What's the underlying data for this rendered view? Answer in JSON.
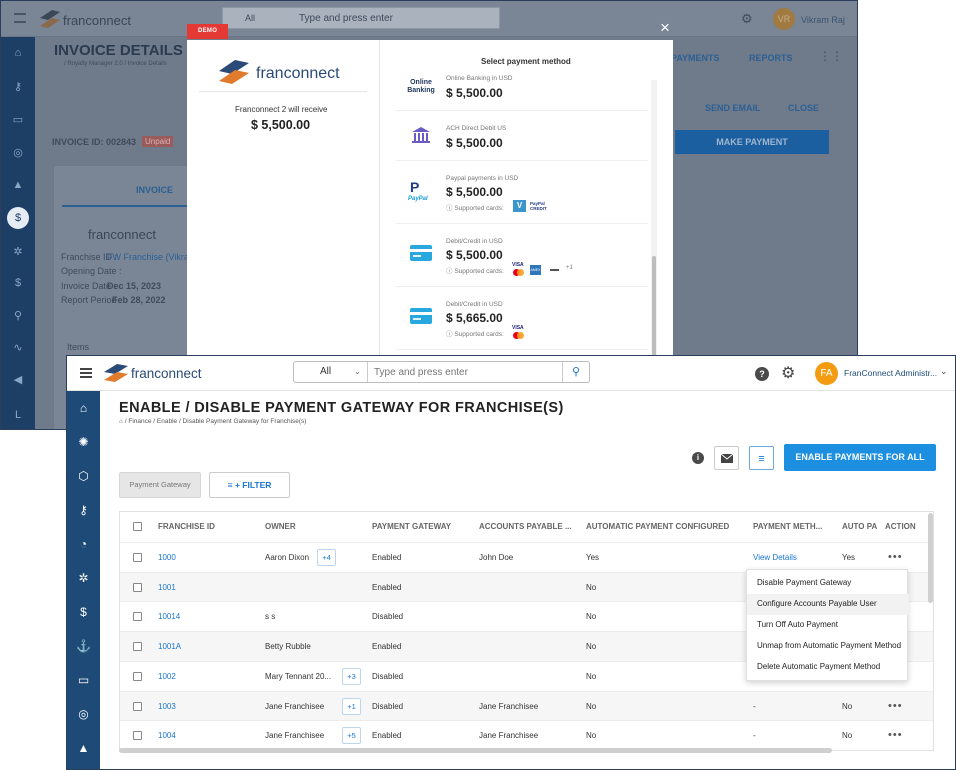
{
  "back_window": {
    "search_scope": "All",
    "search_placeholder": "Type and press enter",
    "user_initials": "VR",
    "user_name": "Vikram Raj",
    "page_title": "INVOICE DETAILS",
    "breadcrumb": "/ Royalty Manager 2.0 / Invoice Details",
    "tabs": [
      "PAYMENTS",
      "REPORTS"
    ],
    "actions": [
      "SEND EMAIL",
      "CLOSE"
    ],
    "make_payment": "MAKE PAYMENT",
    "invoice_id": "INVOICE ID: 002843",
    "status": "Unpaid",
    "invoice_tab": "INVOICE",
    "logo": "franconnect",
    "franchise_id_label": "Franchise ID :",
    "franchise_id_value": "FW Franchise (Vikram R",
    "opening_date_label": "Opening Date :",
    "invoice_date_label": "Invoice Date :",
    "invoice_date_value": "Dec 15, 2023",
    "report_period_label": "Report Period :",
    "report_period_value": "Feb 28, 2022",
    "items_label": "Items"
  },
  "modal": {
    "demo_badge": "DEMO",
    "close_glyph": "×",
    "brand": "franconnect",
    "receive_text": "Franconnect 2 will receive",
    "receive_amount": "$ 5,500.00",
    "header": "Select payment method",
    "methods": [
      {
        "icon": "online-banking-icon",
        "logo_text": "Online Banking",
        "label": "Online Banking in USD",
        "amount": "$ 5,500.00",
        "supported": ""
      },
      {
        "icon": "bank-icon",
        "label": "ACH Direct Debit US",
        "amount": "$ 5,500.00",
        "supported": ""
      },
      {
        "icon": "paypal-icon",
        "logo_text": "PayPal",
        "label": "Paypal payments in USD",
        "amount": "$ 5,500.00",
        "supported": "Supported cards:",
        "cards": [
          "V",
          "PayPal CREDIT"
        ]
      },
      {
        "icon": "credit-card-icon",
        "label": "Debit/Credit in USD",
        "amount": "$ 5,500.00",
        "supported": "Supported cards:",
        "cards": [
          "VISA",
          "AMEX",
          "+1"
        ]
      },
      {
        "icon": "credit-card-icon",
        "label": "Debit/Credit in USD",
        "amount": "$ 5,665.00",
        "supported": "Supported cards:",
        "cards": [
          "VISA"
        ]
      }
    ]
  },
  "front_window": {
    "brand": "franconnect",
    "search_scope": "All",
    "search_placeholder": "Type and press enter",
    "user_initials": "FA",
    "user_name": "FranConnect Administr...",
    "page_title": "ENABLE / DISABLE PAYMENT GATEWAY FOR FRANCHISE(S)",
    "breadcrumb": "/ Finance / Enable / Disable Payment Gateway for Franchise(s)",
    "enable_all_button": "ENABLE PAYMENTS FOR ALL",
    "filter_chip": "Payment Gateway",
    "filter_button": "+ FILTER",
    "columns": [
      "FRANCHISE ID",
      "OWNER",
      "PAYMENT GATEWAY",
      "ACCOUNTS PAYABLE ...",
      "AUTOMATIC PAYMENT CONFIGURED",
      "PAYMENT METH...",
      "AUTO PA",
      "ACTION"
    ],
    "rows": [
      {
        "id": "1000",
        "owner": "Aaron Dixon",
        "extra": "+4",
        "gateway": "Enabled",
        "ap": "John Doe",
        "auto": "Yes",
        "method": "View Details",
        "autopay": "Yes",
        "action": "•••"
      },
      {
        "id": "1001",
        "owner": "",
        "extra": "",
        "gateway": "Enabled",
        "ap": "",
        "auto": "No",
        "method": "",
        "autopay": "",
        "action": ""
      },
      {
        "id": "10014",
        "owner": "s s",
        "extra": "",
        "gateway": "Disabled",
        "ap": "",
        "auto": "No",
        "method": "",
        "autopay": "",
        "action": ""
      },
      {
        "id": "1001A",
        "owner": "Betty Rubble",
        "extra": "",
        "gateway": "Enabled",
        "ap": "",
        "auto": "No",
        "method": "",
        "autopay": "",
        "action": ""
      },
      {
        "id": "1002",
        "owner": "Mary Tennant 20...",
        "extra": "+3",
        "gateway": "Disabled",
        "ap": "",
        "auto": "No",
        "method": "",
        "autopay": "",
        "action": ""
      },
      {
        "id": "1003",
        "owner": "Jane Franchisee",
        "extra": "+1",
        "gateway": "Disabled",
        "ap": "Jane Franchisee",
        "auto": "No",
        "method": "-",
        "autopay": "No",
        "action": "•••"
      },
      {
        "id": "1004",
        "owner": "Jane Franchisee",
        "extra": "+5",
        "gateway": "Enabled",
        "ap": "Jane Franchisee",
        "auto": "No",
        "method": "-",
        "autopay": "No",
        "action": "•••"
      }
    ],
    "action_menu": [
      "Disable Payment Gateway",
      "Configure Accounts Payable User",
      "Turn Off Auto Payment",
      "Unmap from Automatic Payment Method",
      "Delete Automatic Payment Method"
    ]
  },
  "colors": {
    "primary": "#1d8fe1",
    "sidebar": "#1e4a77",
    "link": "#1976d2",
    "demo": "#e53935",
    "avatar": "#f39c12"
  }
}
